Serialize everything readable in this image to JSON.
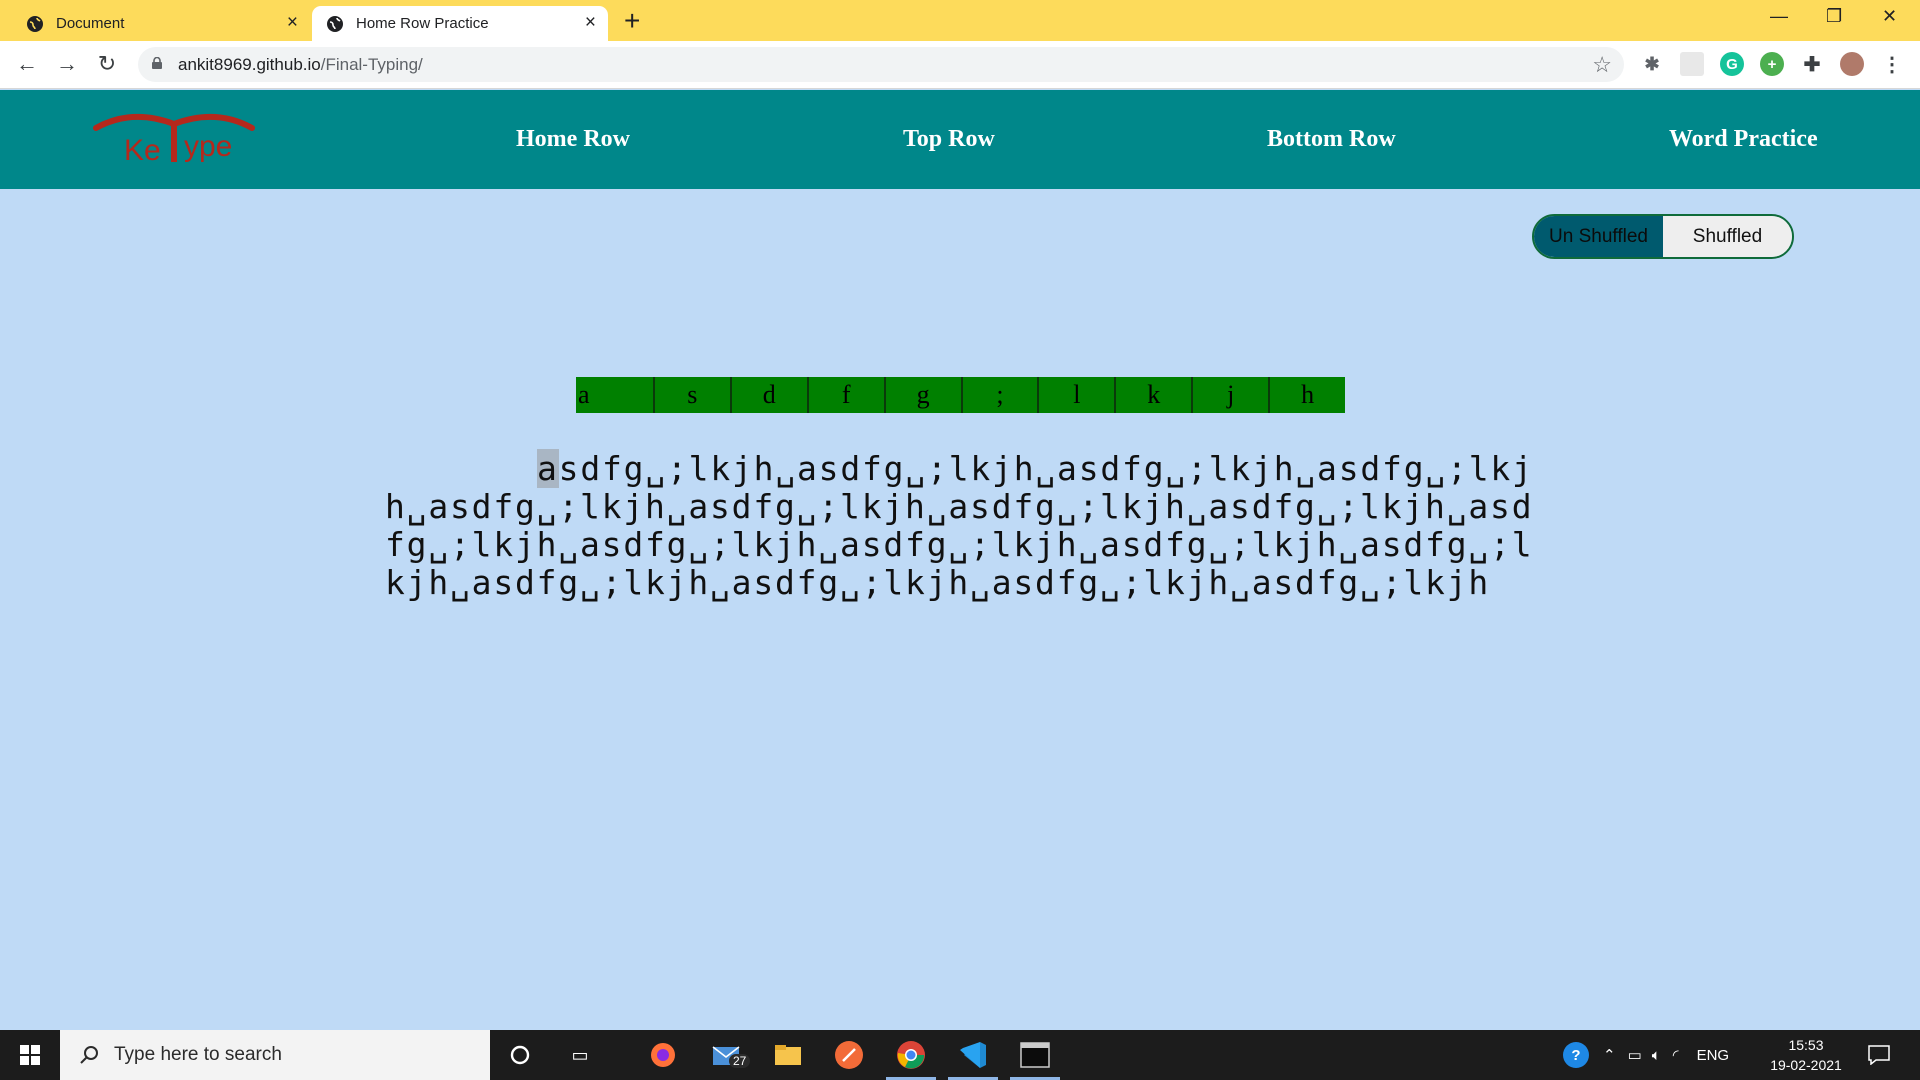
{
  "browser": {
    "tabs": [
      {
        "label": "Document",
        "active": false
      },
      {
        "label": "Home Row Practice",
        "active": true
      }
    ],
    "new_tab_symbol": "+",
    "url_domain": "ankit8969.github.io",
    "url_path": "/Final-Typing/",
    "window_controls": {
      "minimize": "—",
      "maximize": "❐",
      "close": "✕"
    }
  },
  "site": {
    "logo_text_left": "Ke",
    "logo_text_right": "ype",
    "logo_color": "#b5281c",
    "header_color": "#00878a",
    "nav": [
      {
        "label": "Home Row"
      },
      {
        "label": "Top Row"
      },
      {
        "label": "Bottom Row"
      },
      {
        "label": "Word Practice"
      }
    ],
    "toggle": {
      "unshuffled": "Un Shuffled",
      "shuffled": "Shuffled",
      "selected": "Un Shuffled"
    },
    "keys": [
      "a",
      "s",
      "d",
      "f",
      "g",
      ";",
      "l",
      "k",
      "j",
      "h"
    ],
    "key_strip_color": "#008000",
    "practice_first_char": "a",
    "practice_rest": "sdfg␣;lkjh␣asdfg␣;lkjh␣asdfg␣;lkjh␣asdfg␣;lkjh␣asdfg␣;lkjh␣asdfg␣;lkjh␣asdfg␣;lkjh␣asdfg␣;lkjh␣asdfg␣;lkjh␣asdfg␣;lkjh␣asdfg␣;lkjh␣asdfg␣;lkjh␣asdfg␣;lkjh␣asdfg␣;lkjh␣asdfg␣;lkjh␣asdfg␣;lkjh␣asdfg␣;lkjh"
  },
  "taskbar": {
    "search_placeholder": "Type here to search",
    "mail_badge": "27",
    "language": "ENG",
    "time": "15:53",
    "date": "19-02-2021"
  }
}
